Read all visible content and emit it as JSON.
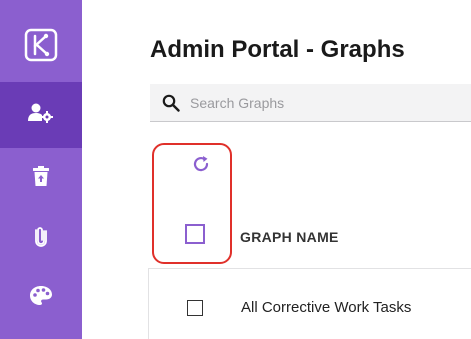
{
  "page": {
    "title": "Admin Portal - Graphs"
  },
  "sidebar": {
    "items": [
      {
        "icon": "logo-icon",
        "active": false
      },
      {
        "icon": "user-settings-icon",
        "active": true
      },
      {
        "icon": "trash-restore-icon",
        "active": false
      },
      {
        "icon": "paperclip-icon",
        "active": false
      },
      {
        "icon": "palette-icon",
        "active": false
      }
    ]
  },
  "search": {
    "placeholder": "Search Graphs",
    "value": ""
  },
  "table": {
    "columns": [
      "GRAPH NAME"
    ],
    "rows": [
      {
        "name": "All Corrective Work Tasks",
        "checked": false
      }
    ]
  },
  "colors": {
    "sidebar": "#8b5fcf",
    "sidebar_active": "#6a3cb6",
    "accent": "#8b5fcf",
    "highlight": "#e0302a"
  }
}
